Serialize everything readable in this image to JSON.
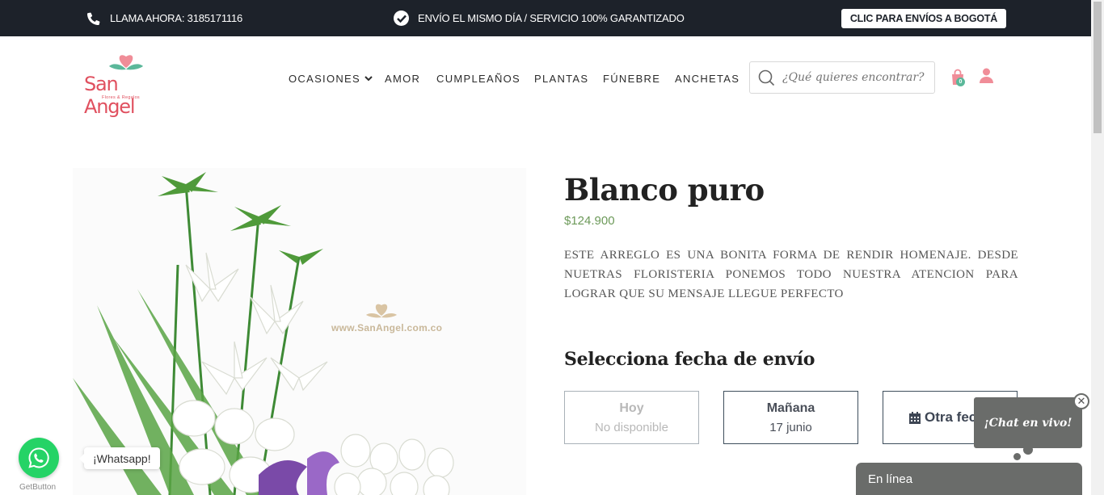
{
  "topbar": {
    "call_label": "LLAMA AHORA: 3185171116",
    "shipping_label": "ENVÍO EL MISMO DÍA / SERVICIO 100% GARANTIZADO",
    "bogota_button": "CLIC PARA ENVÍOS A BOGOTÁ"
  },
  "header": {
    "logo_text": "San Angel",
    "logo_sub": "Flores & Regalos",
    "nav": [
      "OCASIONES",
      "AMOR",
      "CUMPLEAÑOS",
      "PLANTAS",
      "FÚNEBRE",
      "ANCHETAS"
    ],
    "search_placeholder": "¿Qué quieres encontrar?",
    "cart_count": "0"
  },
  "product": {
    "title": "Blanco puro",
    "price": "$124.900",
    "description": "ESTE ARREGLO ES UNA BONITA FORMA DE RENDIR HOMENAJE. DESDE NUETRAS FLORISTERIA PONEMOS TODO NUESTRA ATENCION PARA LOGRAR QUE SU MENSAJE LLEGUE PERFECTO",
    "image_watermark": "www.SanAngel.com.co"
  },
  "delivery": {
    "heading": "Selecciona fecha de envío",
    "today": {
      "label": "Hoy",
      "status": "No disponible"
    },
    "tomorrow": {
      "label": "Mañana",
      "date": "17 junio"
    },
    "other": {
      "label": "Otra fecha"
    }
  },
  "chat": {
    "popup": "¡Chat en vivo!",
    "close": "✕",
    "bar": "En línea"
  },
  "whatsapp": {
    "label": "¡Whatsapp!",
    "brand": "GetButton"
  },
  "colors": {
    "topbar": "#1d222a",
    "brand": "#e0505f",
    "price": "#6d9a5a",
    "chat": "#6a6c6a",
    "whatsapp": "#25d366"
  }
}
